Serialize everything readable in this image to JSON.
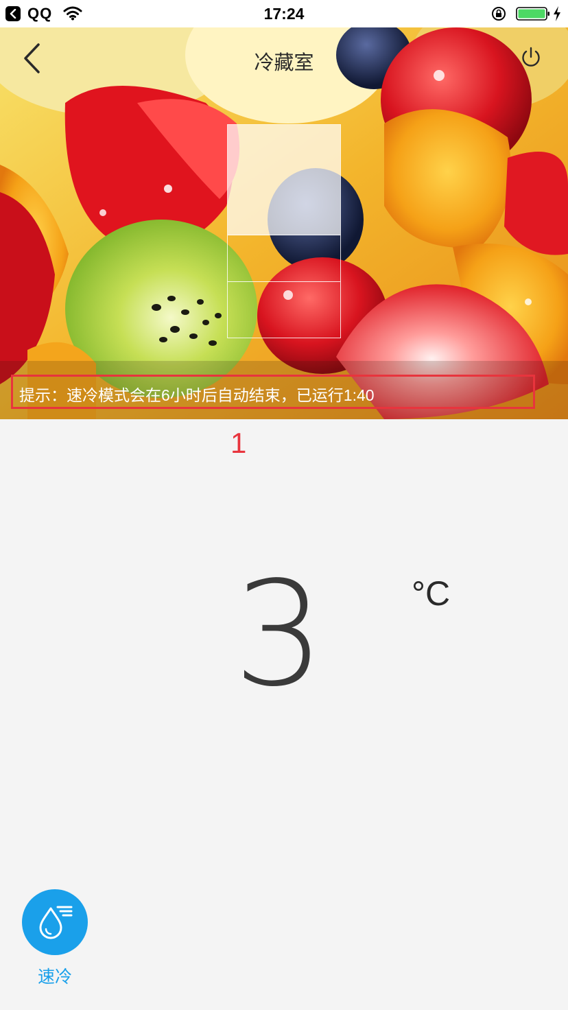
{
  "status_bar": {
    "back_app": "QQ",
    "time": "17:24",
    "battery_color": "#4cd964"
  },
  "header": {
    "title": "冷藏室",
    "back_icon": "chevron-left-icon",
    "power_icon": "power-icon"
  },
  "tip": {
    "text": "提示：速冷模式会在6小时后自动结束，已运行1:40",
    "highlight_color": "#e8343d"
  },
  "annotation": {
    "number": "1"
  },
  "temperature": {
    "value": "3",
    "unit": "°C"
  },
  "quick_cool": {
    "label": "速冷",
    "icon": "water-drop-icon",
    "color": "#1aa0ea"
  }
}
